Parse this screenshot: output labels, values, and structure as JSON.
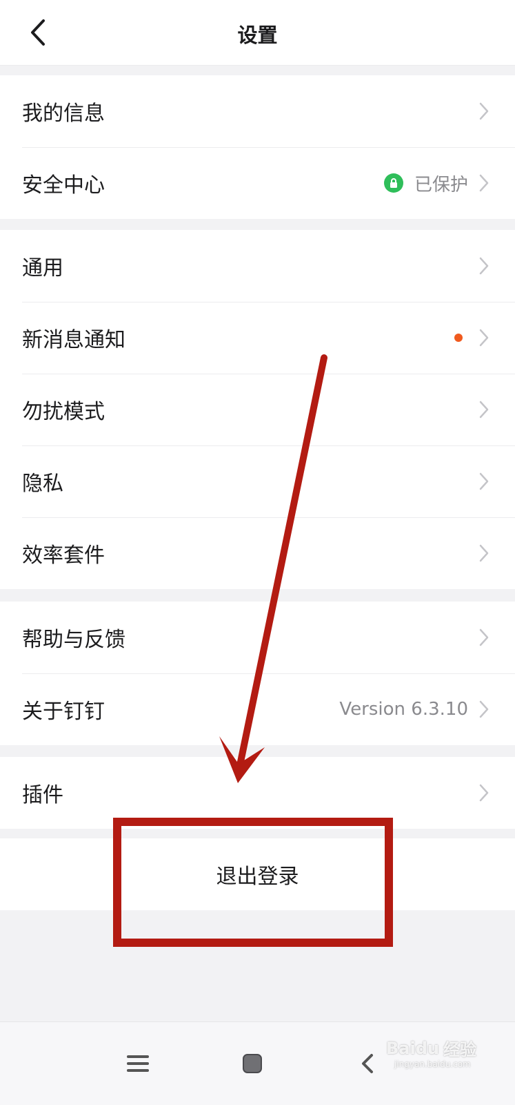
{
  "header": {
    "title": "设置",
    "back_icon": "chevron-left-icon"
  },
  "groups": [
    {
      "items": [
        {
          "label": "我的信息"
        },
        {
          "label": "安全中心",
          "status": "已保护",
          "status_icon": "lock-shield-icon",
          "status_color": "#2fbe5a"
        }
      ]
    },
    {
      "items": [
        {
          "label": "通用"
        },
        {
          "label": "新消息通知",
          "badge_color": "#f05a1e"
        },
        {
          "label": "勿扰模式"
        },
        {
          "label": "隐私"
        },
        {
          "label": "效率套件"
        }
      ]
    },
    {
      "items": [
        {
          "label": "帮助与反馈"
        },
        {
          "label": "关于钉钉",
          "value": "Version 6.3.10"
        }
      ]
    },
    {
      "items": [
        {
          "label": "插件"
        }
      ]
    }
  ],
  "logout": {
    "label": "退出登录"
  },
  "system_nav": {
    "menu_icon": "menu-lines-icon",
    "home_icon": "home-square-icon",
    "back_icon": "back-chevron-icon"
  },
  "annotation": {
    "color": "#b31b12"
  },
  "watermark": {
    "brand": "Baidu",
    "sub": "经验",
    "url": "jingyan.baidu.com"
  }
}
